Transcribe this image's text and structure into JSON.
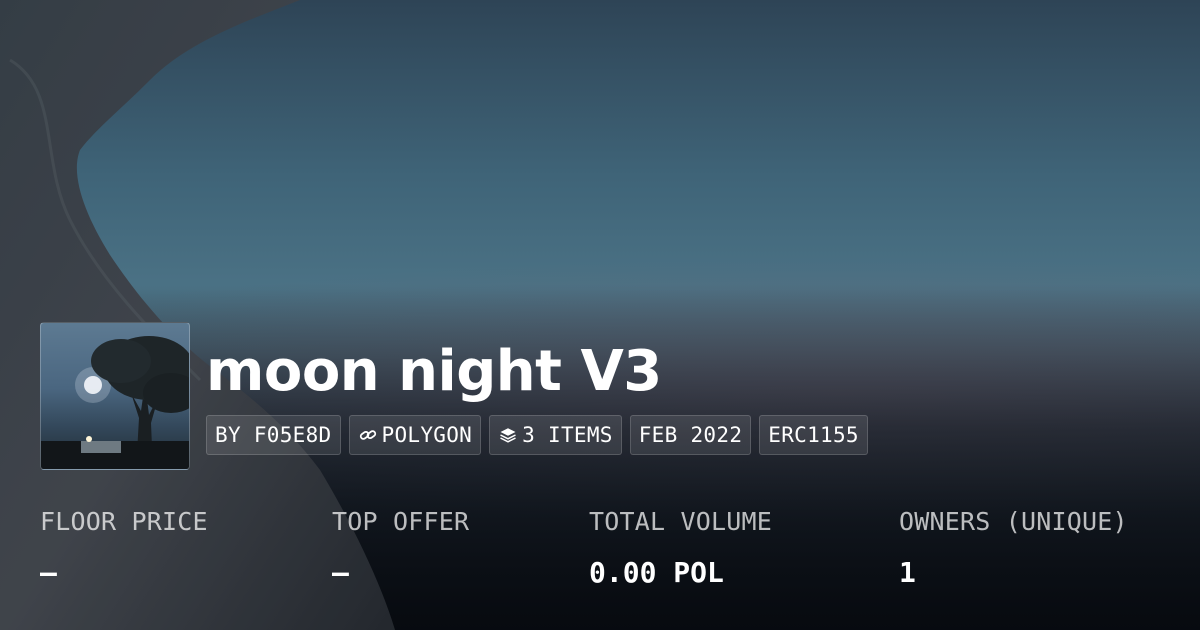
{
  "collection": {
    "title": "moon night V3",
    "thumbnail_icon": "moon-tree-night-thumbnail"
  },
  "chips": {
    "creator": "BY F05E8D",
    "chain": "POLYGON",
    "chain_icon": "link-icon",
    "items": "3 ITEMS",
    "items_icon": "layers-icon",
    "date": "FEB 2022",
    "standard": "ERC1155"
  },
  "stats": {
    "floor_price": {
      "label": "FLOOR PRICE",
      "value": "–"
    },
    "top_offer": {
      "label": "TOP OFFER",
      "value": "–"
    },
    "total_volume": {
      "label": "TOTAL VOLUME",
      "value": "0.00 POL"
    },
    "owners": {
      "label": "OWNERS (UNIQUE)",
      "value": "1"
    }
  },
  "colors": {
    "sky_top": "#2e4456",
    "sky_mid": "#4b7285",
    "bottom_dark": "#151b22",
    "text": "#ffffff"
  }
}
